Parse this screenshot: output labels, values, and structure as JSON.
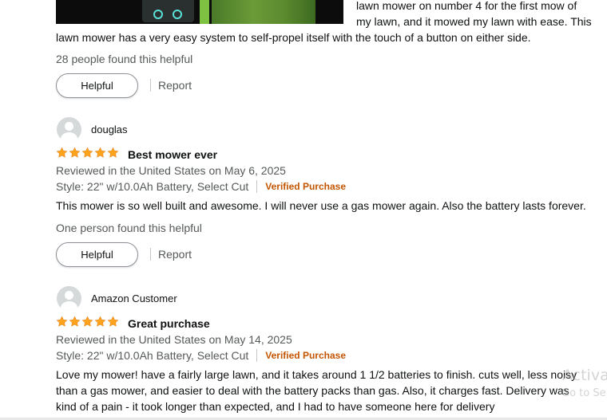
{
  "colors": {
    "star": "#ffa41c",
    "verified": "#c45500",
    "link_gray": "#565959",
    "text": "#0f1111"
  },
  "top_review": {
    "text_right_1": "lawn mower on number 4 for the first mow of",
    "text_right_2": "my lawn, and it mowed my lawn with ease. This",
    "text_full": "lawn mower has a very easy system to self-propel itself with the touch of a button on either side.",
    "helpful_count": "28 people found this helpful",
    "helpful_label": "Helpful",
    "report_label": "Report"
  },
  "reviews": [
    {
      "author": "douglas",
      "rating": 5,
      "title": "Best mower ever",
      "reviewed": "Reviewed in the United States on May 6, 2025",
      "style": "Style: 22\" w/10.0Ah Battery, Select Cut",
      "verified": "Verified Purchase",
      "body": [
        "This mower is so well built and awesome. I will never use a gas mower again. Also the battery lasts forever."
      ],
      "helpful_count": "One person found this helpful",
      "helpful_label": "Helpful",
      "report_label": "Report"
    },
    {
      "author": "Amazon Customer",
      "rating": 5,
      "title": "Great purchase",
      "reviewed": "Reviewed in the United States on May 14, 2025",
      "style": "Style: 22\" w/10.0Ah Battery, Select Cut",
      "verified": "Verified Purchase",
      "body": [
        "Love my mower! have a fairly large lawn, and it takes around 1 1/2 batteries to finish. cuts well, less noisy",
        "than a gas mower, and easier to deal with the battery packs than gas. Also, it charges fast. Delivery was",
        "kind of a pain - it took longer than expected, and I had to have someone here for delivery"
      ]
    }
  ],
  "watermark": {
    "line1": "Activa",
    "line2": "Go to Se"
  }
}
